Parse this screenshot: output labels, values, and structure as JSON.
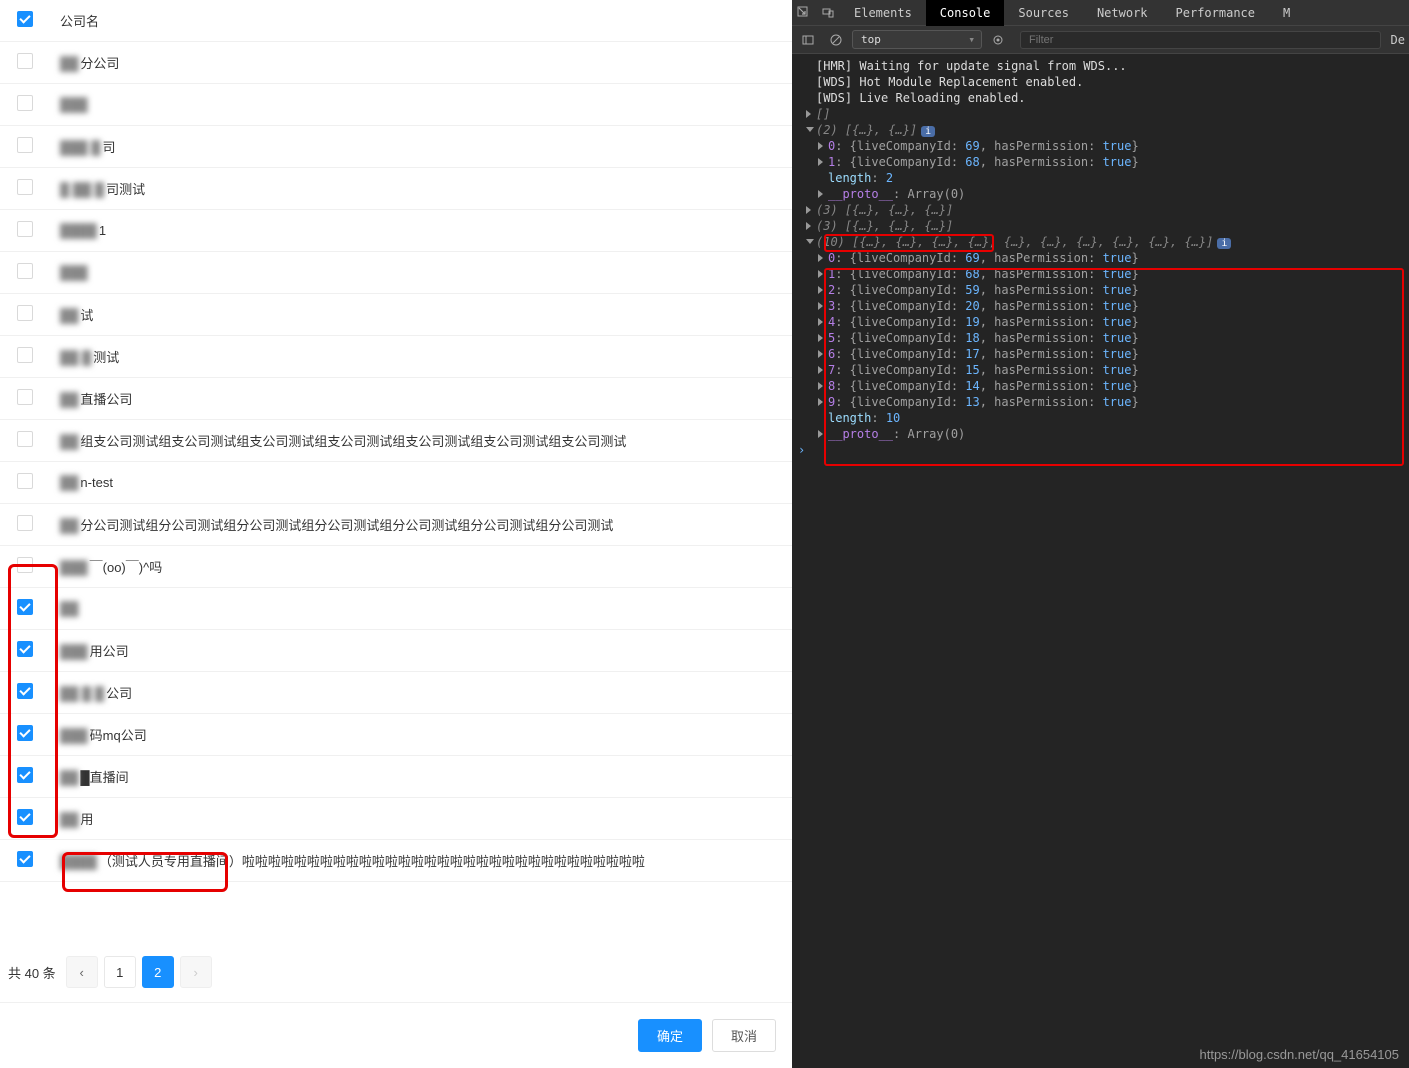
{
  "table": {
    "header": "公司名",
    "rows": [
      {
        "checked": false,
        "prefix": "██",
        "text": "分公司"
      },
      {
        "checked": false,
        "prefix": "███",
        "text": ""
      },
      {
        "checked": false,
        "prefix": "███ █",
        "text": "司"
      },
      {
        "checked": false,
        "prefix": "█ ██ █",
        "text": "司测试"
      },
      {
        "checked": false,
        "prefix": "████",
        "text": "1"
      },
      {
        "checked": false,
        "prefix": "███",
        "text": ""
      },
      {
        "checked": false,
        "prefix": "██ ",
        "text": "试"
      },
      {
        "checked": false,
        "prefix": "██  █",
        "text": "测试"
      },
      {
        "checked": false,
        "prefix": "██",
        "text": "直播公司"
      },
      {
        "checked": false,
        "prefix": "██",
        "text": "组支公司测试组支公司测试组支公司测试组支公司测试组支公司测试组支公司测试组支公司测试"
      },
      {
        "checked": false,
        "prefix": "██",
        "text": "n-test"
      },
      {
        "checked": false,
        "prefix": "██",
        "text": "分公司测试组分公司测试组分公司测试组分公司测试组分公司测试组分公司测试组分公司测试"
      },
      {
        "checked": false,
        "prefix": "███",
        "text": "￣(oo)￣)^吗"
      },
      {
        "checked": true,
        "prefix": "██",
        "text": ""
      },
      {
        "checked": true,
        "prefix": "███",
        "text": "用公司"
      },
      {
        "checked": true,
        "prefix": "██ █ █",
        "text": "公司"
      },
      {
        "checked": true,
        "prefix": "███",
        "text": "码mq公司"
      },
      {
        "checked": true,
        "prefix": "██",
        "text": "█直播间"
      },
      {
        "checked": true,
        "prefix": "██",
        "text": "用"
      },
      {
        "checked": true,
        "prefix": "████",
        "text": "（测试人员专用直播间）啦啦啦啦啦啦啦啦啦啦啦啦啦啦啦啦啦啦啦啦啦啦啦啦啦啦啦啦啦啦啦"
      }
    ],
    "total_text": "共 40 条",
    "pages": [
      "1",
      "2"
    ],
    "active_page": 2,
    "confirm": "确定",
    "cancel": "取消"
  },
  "devtools": {
    "tabs": [
      "Elements",
      "Console",
      "Sources",
      "Network",
      "Performance",
      "M"
    ],
    "active_tab": 1,
    "context": "top",
    "filter_placeholder": "Filter",
    "default_label": "De",
    "logs": {
      "msg1": "[HMR] Waiting for update signal from WDS...",
      "msg2": "[WDS] Hot Module Replacement enabled.",
      "msg3": "[WDS] Live Reloading enabled.",
      "empty_array": "[]",
      "arr2_header": "(2) [{…}, {…}]",
      "arr2_items": [
        {
          "idx": "0",
          "id": 69,
          "perm": "true"
        },
        {
          "idx": "1",
          "id": 68,
          "perm": "true"
        }
      ],
      "arr2_length": "2",
      "proto_label": "__proto__",
      "proto_val": ": Array(0)",
      "arr3a": "(3) [{…}, {…}, {…}]",
      "arr3b": "(3) [{…}, {…}, {…}]",
      "arr10_header": "(10) [{…}, {…}, {…}, {…}, {…}, {…}, {…}, {…}, {…}, {…}]",
      "arr10_items": [
        {
          "idx": "0",
          "id": 69,
          "perm": "true"
        },
        {
          "idx": "1",
          "id": 68,
          "perm": "true"
        },
        {
          "idx": "2",
          "id": 59,
          "perm": "true"
        },
        {
          "idx": "3",
          "id": 20,
          "perm": "true"
        },
        {
          "idx": "4",
          "id": 19,
          "perm": "true"
        },
        {
          "idx": "5",
          "id": 18,
          "perm": "true"
        },
        {
          "idx": "6",
          "id": 17,
          "perm": "true"
        },
        {
          "idx": "7",
          "id": 15,
          "perm": "true"
        },
        {
          "idx": "8",
          "id": 14,
          "perm": "true"
        },
        {
          "idx": "9",
          "id": 13,
          "perm": "true"
        }
      ],
      "arr10_length": "10",
      "key_company": "liveCompanyId",
      "key_perm": "hasPermission",
      "length_label": "length"
    }
  },
  "watermark": "https://blog.csdn.net/qq_41654105"
}
